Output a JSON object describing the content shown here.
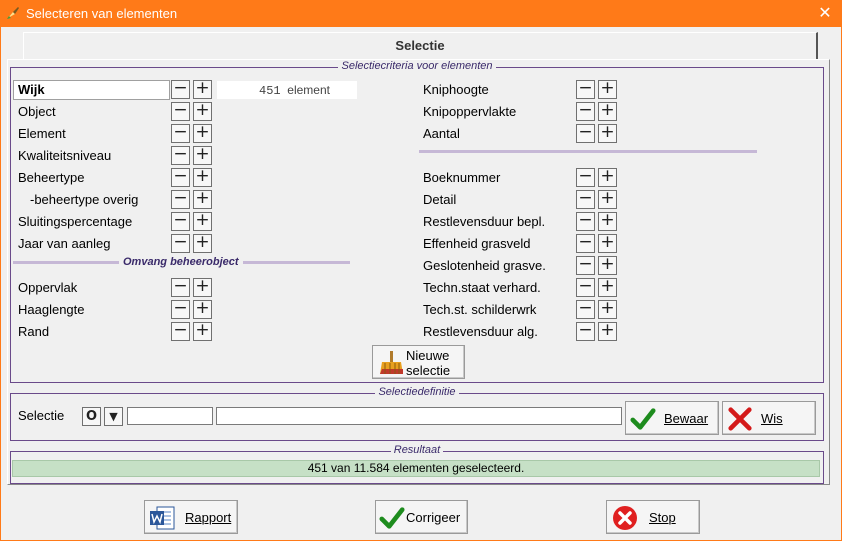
{
  "window": {
    "title": "Selecteren van elementen",
    "close_glyph": "✕"
  },
  "tab": {
    "title": "Selectie"
  },
  "criteria": {
    "legend": "Selectiecriteria voor elementen",
    "left": [
      {
        "label": "Wijk",
        "active": true
      },
      {
        "label": "Object"
      },
      {
        "label": "Element"
      },
      {
        "label": "Kwaliteitsniveau"
      },
      {
        "label": "Beheertype"
      },
      {
        "label": "-beheertype overig"
      },
      {
        "label": "Sluitingspercentage"
      },
      {
        "label": "Jaar van aanleg"
      }
    ],
    "count": {
      "value": "451",
      "unit": "element"
    },
    "omvang_label": "Omvang beheerobject",
    "omvang": [
      {
        "label": "Oppervlak"
      },
      {
        "label": "Haaglengte"
      },
      {
        "label": "Rand"
      }
    ],
    "right_top": [
      {
        "label": "Kniphoogte"
      },
      {
        "label": "Knipoppervlakte"
      },
      {
        "label": "Aantal"
      }
    ],
    "right_bottom": [
      {
        "label": "Boeknummer"
      },
      {
        "label": "Detail"
      },
      {
        "label": "Restlevensduur bepl."
      },
      {
        "label": "Effenheid grasveld"
      },
      {
        "label": "Geslotenheid grasve."
      },
      {
        "label": "Techn.staat verhard."
      },
      {
        "label": "Tech.st. schilderwrk"
      },
      {
        "label": "Restlevensduur alg."
      }
    ],
    "minus": "−",
    "plus": "+",
    "nieuwe_selectie": [
      "Nieuwe",
      "selectie"
    ]
  },
  "definitie": {
    "legend": "Selectiedefinitie",
    "label": "Selectie",
    "btn_o": "O",
    "btn_down": "▼",
    "code_value": "",
    "desc_value": "",
    "bewaar": "Bewaar",
    "wis": "Wis"
  },
  "resultaat": {
    "legend": "Resultaat",
    "text": "451 van 11.584 elementen geselecteerd."
  },
  "bottom": {
    "rapport": "Rapport",
    "corrigeer": "Corrigeer",
    "stop": "Stop"
  },
  "colors": {
    "titlebar": "#ff7a18",
    "status_bg": "#c6e0c6",
    "check_green": "#1e8c1e",
    "wis_red": "#d41a1a",
    "stop_red": "#e02020"
  }
}
